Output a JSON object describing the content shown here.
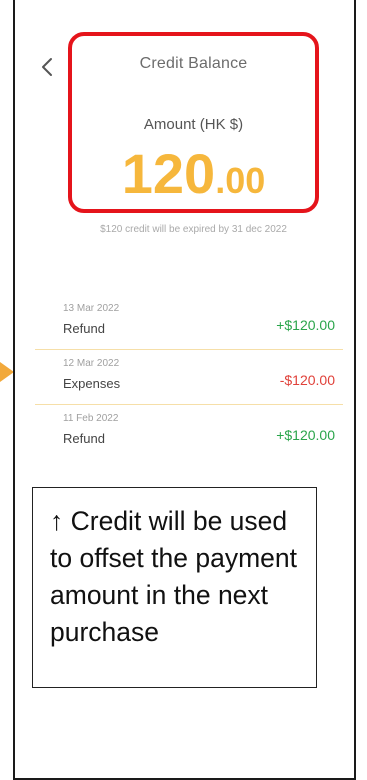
{
  "header": {
    "title": "Credit Balance",
    "back_icon": "chevron-left-icon"
  },
  "balance": {
    "label": "Amount (HK $)",
    "value_integer": "120",
    "value_decimal": ".00",
    "expiry_note": "$120 credit will be expired by 31 dec 2022",
    "accent_color": "#f6b73c"
  },
  "transactions": [
    {
      "date": "13 Mar 2022",
      "type": "Refund",
      "amount": "+$120.00",
      "direction": "credit"
    },
    {
      "date": "12 Mar 2022",
      "type": "Expenses",
      "amount": "-$120.00",
      "direction": "debit"
    },
    {
      "date": "11 Feb 2022",
      "type": "Refund",
      "amount": "+$120.00",
      "direction": "credit"
    }
  ],
  "callout": {
    "text": "↑ Credit will be used to offset the payment amount in the next purchase"
  },
  "colors": {
    "highlight_border": "#e5141b",
    "positive": "#2aa54b",
    "negative": "#e0413a",
    "pointer_arrow": "#f2a93b"
  }
}
